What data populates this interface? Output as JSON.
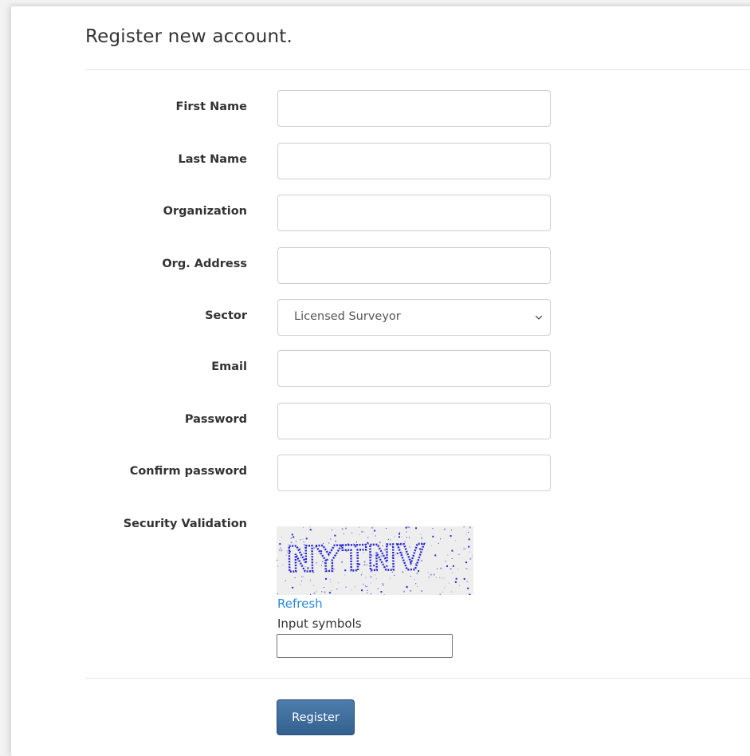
{
  "page": {
    "title": "Register new account."
  },
  "form": {
    "fields": [
      {
        "label": "First Name",
        "value": ""
      },
      {
        "label": "Last Name",
        "value": ""
      },
      {
        "label": "Organization",
        "value": ""
      },
      {
        "label": "Org. Address",
        "value": ""
      },
      {
        "label": "Sector",
        "value": "Licensed Surveyor"
      },
      {
        "label": "Email",
        "value": ""
      },
      {
        "label": "Password",
        "value": ""
      },
      {
        "label": "Confirm password",
        "value": ""
      }
    ]
  },
  "security": {
    "label": "Security Validation",
    "captcha_text": "NYTNV",
    "refresh_label": "Refresh",
    "input_label": "Input symbols",
    "input_value": ""
  },
  "actions": {
    "register_label": "Register"
  },
  "colors": {
    "link": "#2a8ad8",
    "button_bg": "#3c6a98",
    "captcha_text": "#2323d6"
  }
}
